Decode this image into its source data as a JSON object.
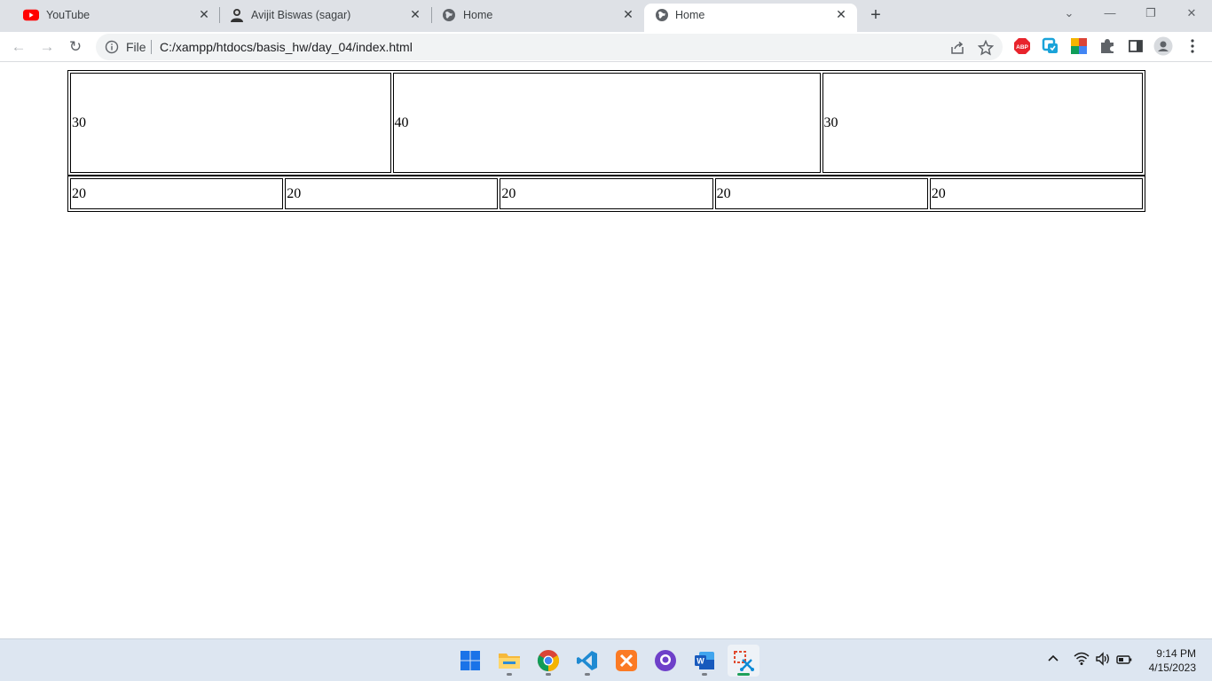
{
  "browser": {
    "tabs": [
      {
        "title": "YouTube",
        "icon": "youtube-icon",
        "active": false
      },
      {
        "title": "Avijit Biswas (sagar)",
        "icon": "profile-avatar-icon",
        "active": false
      },
      {
        "title": "Home",
        "icon": "globe-icon",
        "active": false
      },
      {
        "title": "Home",
        "icon": "globe-icon",
        "active": true
      }
    ],
    "new_tab_label": "+",
    "address": {
      "scheme_label": "File",
      "url": "C:/xampp/htdocs/basis_hw/day_04/index.html"
    },
    "extensions": [
      "adblock-plus-icon",
      "extension-green-icon",
      "extension-colorful-icon",
      "puzzle-icon",
      "side-panel-icon",
      "profile-icon",
      "kebab-menu-icon"
    ]
  },
  "page": {
    "top_row": [
      "30",
      "40",
      "30"
    ],
    "bottom_row": [
      "20",
      "20",
      "20",
      "20",
      "20"
    ]
  },
  "taskbar": {
    "apps": [
      "windows-start-icon",
      "file-explorer-icon",
      "chrome-icon",
      "vscode-icon",
      "xampp-icon",
      "github-desktop-icon",
      "word-icon",
      "snipping-tool-icon"
    ],
    "time": "9:14 PM",
    "date": "4/15/2023"
  },
  "colors": {
    "tabstrip_bg": "#dee1e6",
    "taskbar_bg": "#dde6f1",
    "youtube_red": "#ff0000"
  }
}
